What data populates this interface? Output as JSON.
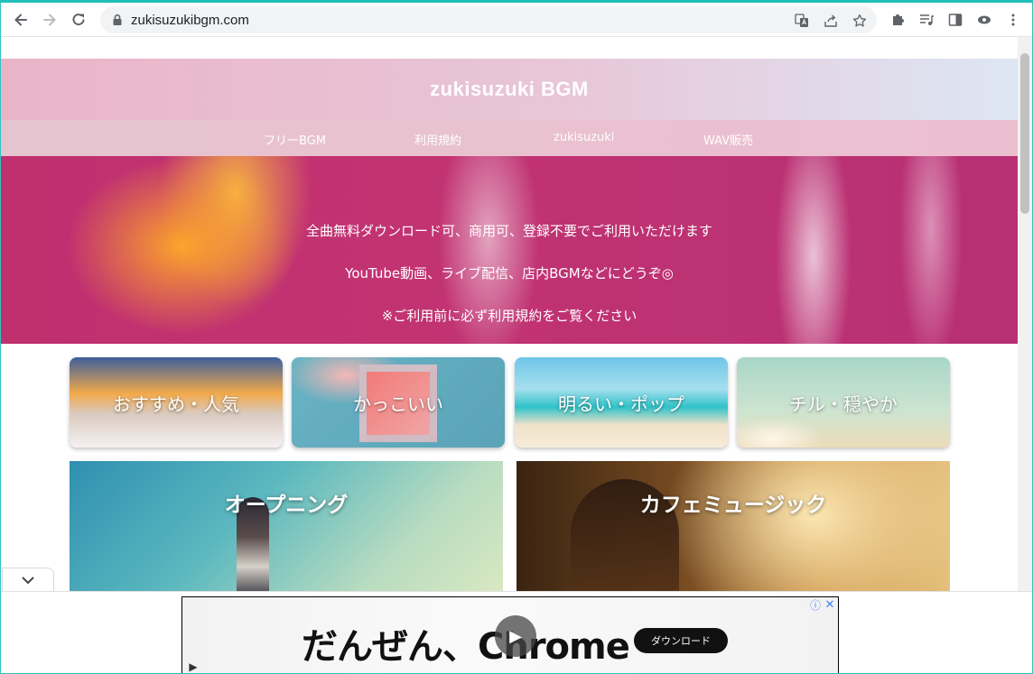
{
  "browser": {
    "url": "zukisuzukibgm.com"
  },
  "site": {
    "title": "zukisuzuki BGM",
    "nav": [
      "フリーBGM",
      "利用規約",
      "zukisuzuki",
      "WAV販売"
    ]
  },
  "hero": {
    "lines": [
      "全曲無料ダウンロード可、商用可、登録不要でご利用いただけます",
      "YouTube動画、ライブ配信、店内BGMなどにどうぞ◎",
      "※ご利用前に必ず利用規約をご覧ください"
    ]
  },
  "categories": [
    "おすすめ・人気",
    "かっこいい",
    "明るい・ポップ",
    "チル・穏やか"
  ],
  "features": [
    "オープニング",
    "カフェミュージック"
  ],
  "ad": {
    "headline": "だんぜん、Chrome",
    "cta": "ダウンロード"
  },
  "icons": {
    "back": "arrow-left-icon",
    "forward": "arrow-right-icon",
    "reload": "reload-icon",
    "lock": "lock-icon",
    "translate": "translate-icon",
    "share": "share-icon",
    "bookmark": "star-icon",
    "extensions": "puzzle-icon",
    "media": "media-queue-icon",
    "sidepanel": "side-panel-icon",
    "profile": "profile-icon",
    "menu": "kebab-menu-icon"
  },
  "colors": {
    "header_pink": "#eab4c8",
    "nav_pink": "#ecbfd0",
    "hero_magenta": "#c0306f",
    "accent_teal": "#1fbfb8"
  }
}
